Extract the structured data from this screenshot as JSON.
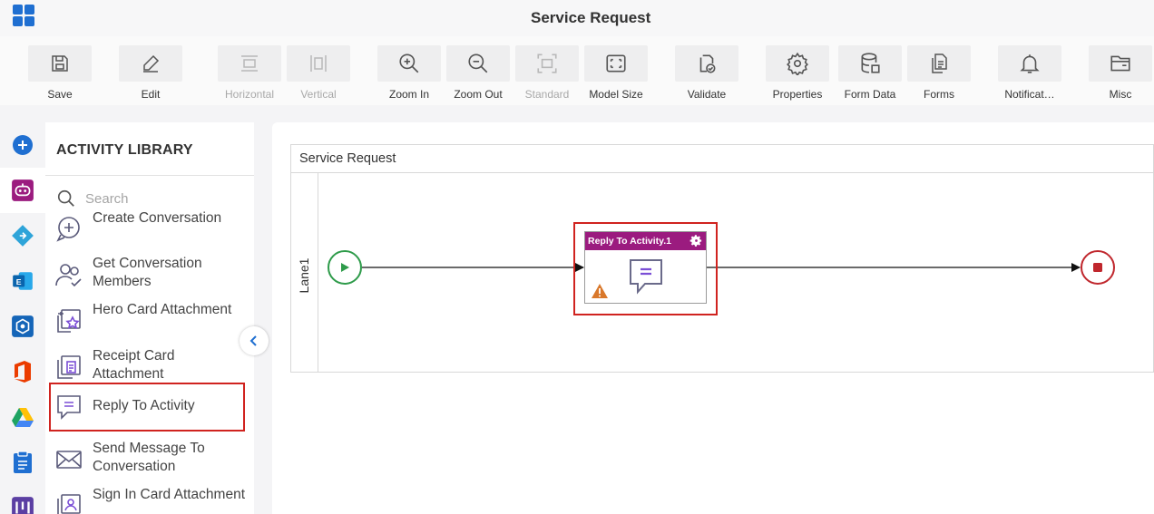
{
  "app": {
    "title": "Service Request"
  },
  "toolbar": {
    "items": [
      {
        "label": "Save",
        "icon": "save-icon",
        "enabled": true
      },
      {
        "label": "Edit",
        "icon": "edit-icon",
        "enabled": true
      },
      {
        "label": "Horizontal",
        "icon": "horizontal-layout-icon",
        "enabled": false
      },
      {
        "label": "Vertical",
        "icon": "vertical-layout-icon",
        "enabled": false
      },
      {
        "label": "Zoom In",
        "icon": "zoom-in-icon",
        "enabled": true
      },
      {
        "label": "Zoom Out",
        "icon": "zoom-out-icon",
        "enabled": true
      },
      {
        "label": "Standard",
        "icon": "standard-size-icon",
        "enabled": false
      },
      {
        "label": "Model Size",
        "icon": "model-size-icon",
        "enabled": true
      },
      {
        "label": "Validate",
        "icon": "validate-icon",
        "enabled": true
      },
      {
        "label": "Properties",
        "icon": "gear-icon",
        "enabled": true
      },
      {
        "label": "Form Data",
        "icon": "database-icon",
        "enabled": true
      },
      {
        "label": "Forms",
        "icon": "forms-icon",
        "enabled": true
      },
      {
        "label": "Notificat…",
        "icon": "bell-icon",
        "enabled": true
      },
      {
        "label": "Misc",
        "icon": "folder-icon",
        "enabled": true
      }
    ]
  },
  "rail": {
    "items": [
      {
        "icon": "add-icon",
        "active": false
      },
      {
        "icon": "bot-icon",
        "active": true
      },
      {
        "icon": "azure-devops-icon",
        "active": false
      },
      {
        "icon": "exchange-icon",
        "active": false
      },
      {
        "icon": "hexagon-service-icon",
        "active": false
      },
      {
        "icon": "office-icon",
        "active": false
      },
      {
        "icon": "google-drive-icon",
        "active": false
      },
      {
        "icon": "clipboard-icon",
        "active": false
      },
      {
        "icon": "kanban-icon",
        "active": false
      }
    ]
  },
  "library": {
    "title": "ACTIVITY LIBRARY",
    "search_placeholder": "Search",
    "items": [
      {
        "label": "Create Conversation",
        "icon": "create-conversation-icon"
      },
      {
        "label": "Get Conversation Members",
        "icon": "conversation-members-icon"
      },
      {
        "label": "Hero Card Attachment",
        "icon": "hero-card-icon"
      },
      {
        "label": "Receipt Card Attachment",
        "icon": "receipt-card-icon"
      },
      {
        "label": "Reply To Activity",
        "icon": "reply-icon",
        "highlighted": true
      },
      {
        "label": "Send Message To Conversation",
        "icon": "send-message-icon"
      },
      {
        "label": "Sign In Card Attachment",
        "icon": "sign-in-card-icon"
      }
    ]
  },
  "canvas": {
    "pool_title": "Service Request",
    "lane_label": "Lane1",
    "task": {
      "title": "Reply To Activity.1",
      "header_color": "#9b1b7f",
      "has_warning": true
    }
  },
  "colors": {
    "accent": "#1f6fd1",
    "highlight": "#d0231f",
    "start_event": "#2e9b4a",
    "end_event": "#c0272d",
    "task_header": "#9b1b7f"
  }
}
